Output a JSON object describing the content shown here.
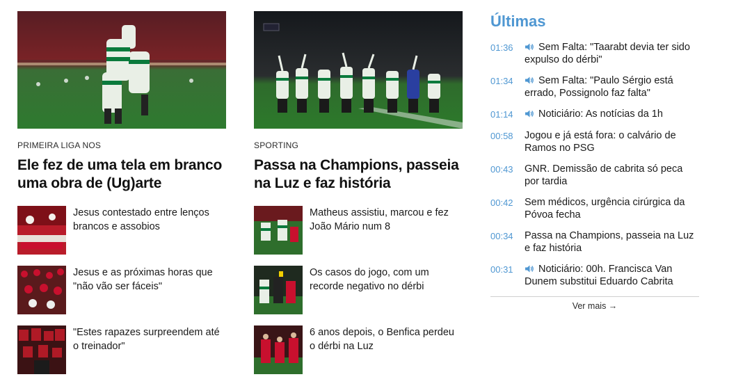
{
  "featured": [
    {
      "kicker": "PRIMEIRA LIGA NOS",
      "headline": "Ele fez de uma tela em branco uma obra de (Ug)arte",
      "related": [
        {
          "title": "Jesus contestado entre lenços brancos e assobios"
        },
        {
          "title": "Jesus e as próximas horas que \"não vão ser fáceis\""
        },
        {
          "title": "\"Estes rapazes surpreendem até o treinador\""
        }
      ]
    },
    {
      "kicker": "SPORTING",
      "headline": "Passa na Champions, passeia na Luz e faz história",
      "related": [
        {
          "title": "Matheus assistiu, marcou e fez João Mário num 8"
        },
        {
          "title": "Os casos do jogo, com um recorde negativo no dérbi"
        },
        {
          "title": "6 anos depois, o Benfica perdeu o dérbi na Luz"
        }
      ]
    }
  ],
  "ultimas": {
    "title": "Últimas",
    "items": [
      {
        "time": "01:36",
        "audio": true,
        "text": "Sem Falta: \"Taarabt devia ter sido expulso do dérbi\""
      },
      {
        "time": "01:34",
        "audio": true,
        "text": "Sem Falta: \"Paulo Sérgio está errado, Possignolo faz falta\""
      },
      {
        "time": "01:14",
        "audio": true,
        "text": "Noticiário: As notícias da 1h"
      },
      {
        "time": "00:58",
        "audio": false,
        "text": "Jogou e já está fora: o calvário de Ramos no PSG"
      },
      {
        "time": "00:43",
        "audio": false,
        "text": "GNR. Demissão de cabrita só peca por tardia"
      },
      {
        "time": "00:42",
        "audio": false,
        "text": "Sem médicos, urgência cirúrgica da Póvoa fecha"
      },
      {
        "time": "00:34",
        "audio": false,
        "text": "Passa na Champions, passeia na Luz e faz história"
      },
      {
        "time": "00:31",
        "audio": true,
        "text": "Noticiário: 00h. Francisca Van Dunem substitui Eduardo Cabrita"
      }
    ],
    "more_label": "Ver mais →"
  },
  "colors": {
    "accent": "#4f97d2",
    "pitch": "#3f8f3a",
    "benfica_red": "#c8102e",
    "sporting_green": "#0a7a3c"
  }
}
